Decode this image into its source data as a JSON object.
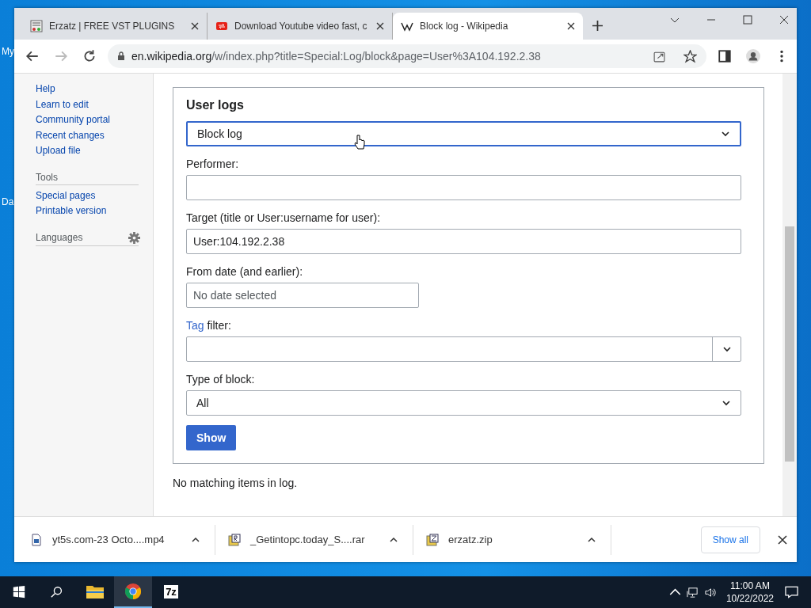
{
  "desktop": {
    "labels": [
      "My",
      "Da"
    ]
  },
  "tabs": [
    {
      "title": "Erzatz | FREE VST PLUGINS",
      "selected": false,
      "kind": "erzatz"
    },
    {
      "title": "Download Youtube video fast, c",
      "selected": false,
      "kind": "yt"
    },
    {
      "title": "Block log - Wikipedia",
      "selected": true,
      "kind": "wiki"
    }
  ],
  "address": {
    "host": "en.wikipedia.org",
    "path": "/w/index.php?title=Special:Log/block&page=User%3A104.192.2.38"
  },
  "sidebar": {
    "links": [
      "Help",
      "Learn to edit",
      "Community portal",
      "Recent changes",
      "Upload file"
    ],
    "groups": [
      {
        "heading": "Tools",
        "links": [
          "Special pages",
          "Printable version"
        ]
      },
      {
        "heading": "Languages",
        "settings": true
      }
    ]
  },
  "form": {
    "legend": "User logs",
    "fields": [
      {
        "kind": "select",
        "value": "Block log",
        "focused": true
      },
      {
        "kind": "input",
        "label": "Performer:"
      },
      {
        "kind": "input",
        "label": "Target (title or User:username for user):",
        "value": "User:104.192.2.38"
      },
      {
        "kind": "date",
        "label": "From date (and earlier):",
        "placeholder": "No date selected"
      },
      {
        "kind": "combo",
        "label_link": "Tag",
        "label": " filter:"
      },
      {
        "kind": "select",
        "label": "Type of block:",
        "value": "All",
        "focused": false
      }
    ],
    "button": "Show"
  },
  "message": "No matching items in log.",
  "downloads": [
    {
      "name": "yt5s.com-23 Octo....mp4",
      "kind": "video"
    },
    {
      "name": "_Getintopc.today_S....rar",
      "kind": "rar"
    },
    {
      "name": "erzatz.zip",
      "kind": "zip"
    }
  ],
  "show_all": "Show all",
  "taskbar": {
    "apps": [
      {
        "kind": "explorer",
        "selected": false
      },
      {
        "kind": "chrome",
        "selected": true
      },
      {
        "kind": "sevenzip",
        "label": "7z",
        "selected": false
      }
    ],
    "time": "11:00 AM",
    "date": "10/22/2022"
  }
}
